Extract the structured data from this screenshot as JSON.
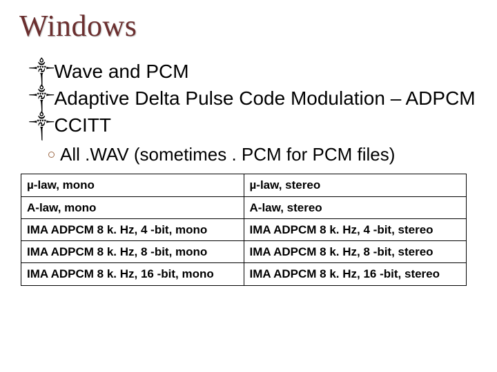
{
  "title": "Windows",
  "bullets": {
    "b1": "Wave and PCM",
    "b2": "Adaptive Delta Pulse Code Modulation – ADPCM",
    "b3": "CCITT",
    "sub1": "All .WAV (sometimes . PCM for PCM files)"
  },
  "bullet_symbol": "༒",
  "table": {
    "r0c0": "µ-law, mono",
    "r0c1": "µ-law, stereo",
    "r1c0": "A-law, mono",
    "r1c1": "A-law, stereo",
    "r2c0": "IMA ADPCM 8 k. Hz, 4 -bit, mono",
    "r2c1": "IMA ADPCM 8 k. Hz, 4 -bit, stereo",
    "r3c0": "IMA ADPCM 8 k. Hz, 8 -bit, mono",
    "r3c1": "IMA ADPCM 8 k. Hz, 8 -bit, stereo",
    "r4c0": "IMA ADPCM 8 k. Hz, 16 -bit, mono",
    "r4c1": "IMA ADPCM 8 k. Hz, 16 -bit, stereo"
  }
}
